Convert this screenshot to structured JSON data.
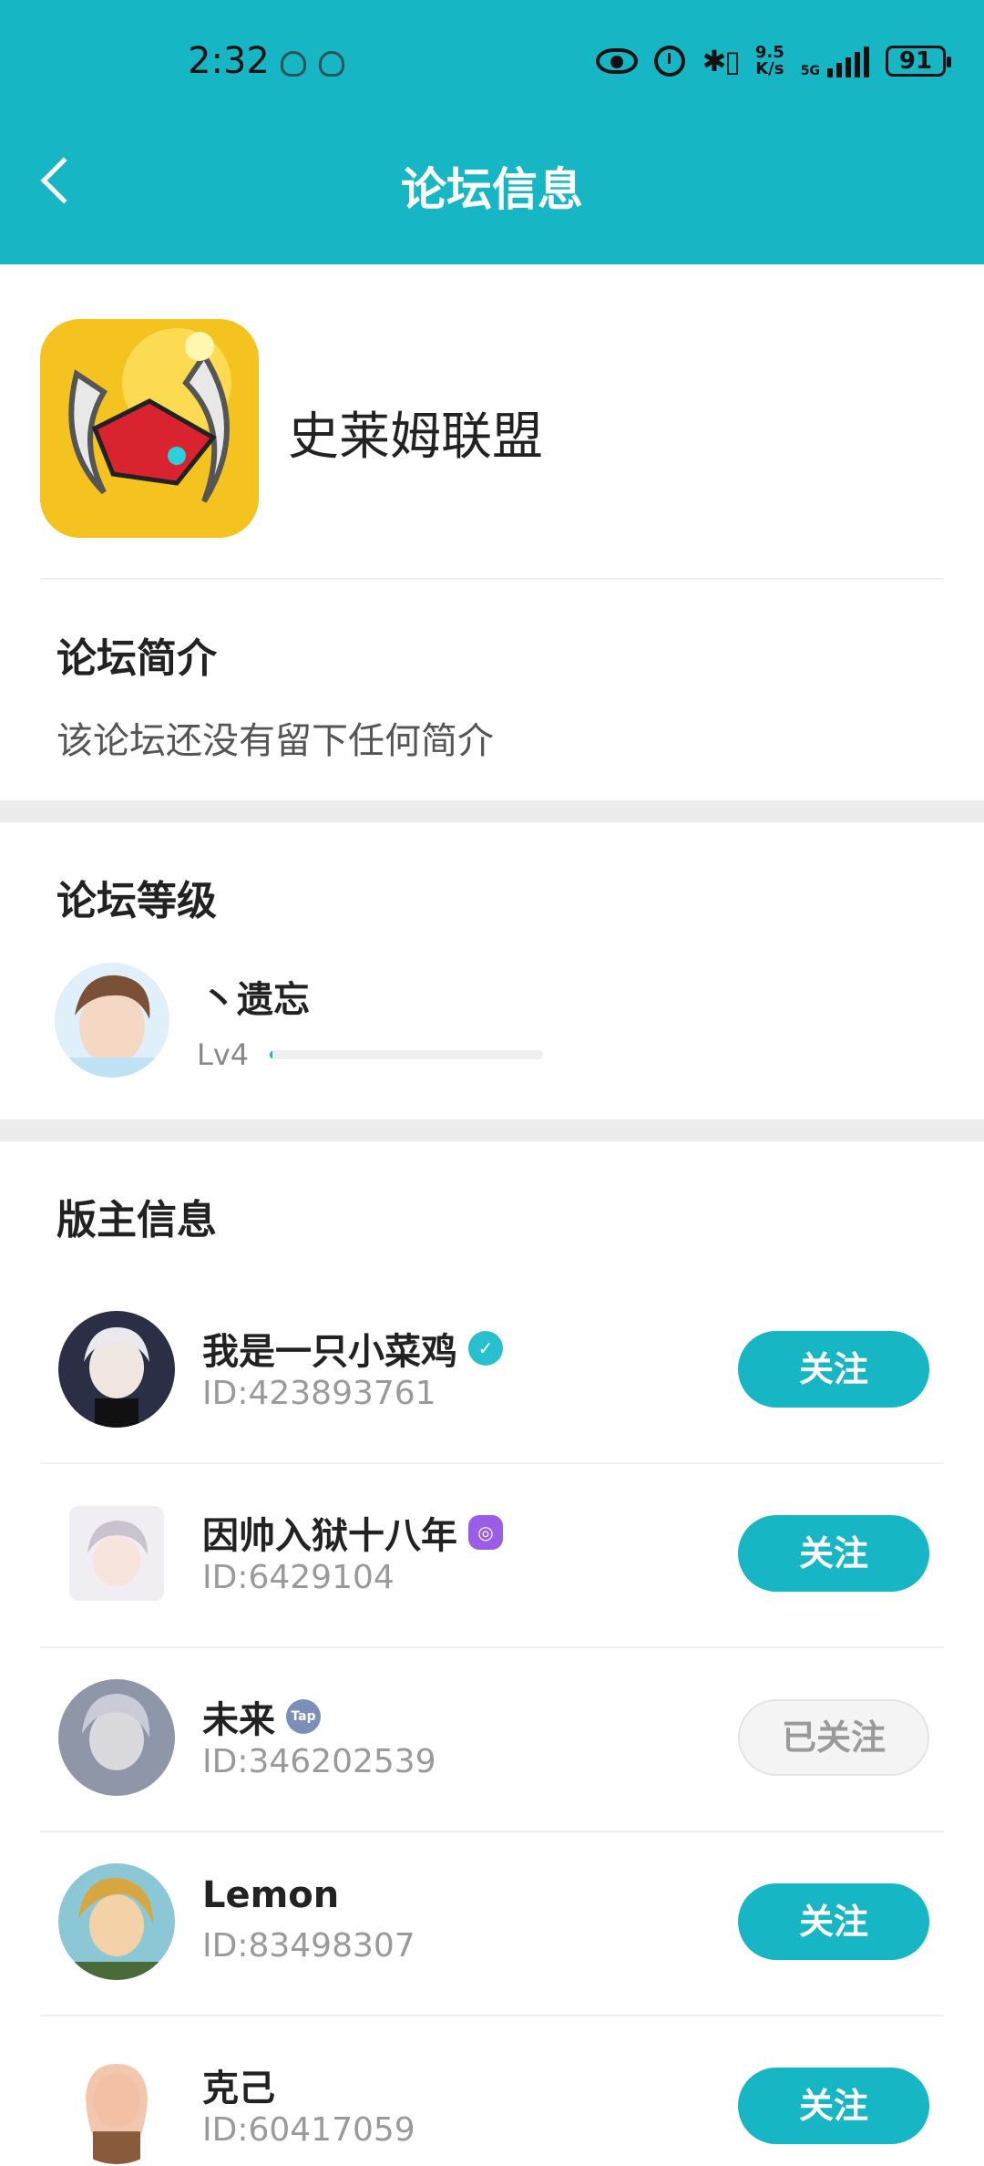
{
  "status_bar": {
    "time": "2:32",
    "net_speed_top": "9.5",
    "net_speed_unit": "K/s",
    "network_type": "5G",
    "battery": "91"
  },
  "header": {
    "title": "论坛信息"
  },
  "forum": {
    "name": "史莱姆联盟"
  },
  "intro": {
    "title": "论坛简介",
    "text": "该论坛还没有留下任何简介"
  },
  "level": {
    "title": "论坛等级",
    "user_name": "丶遗忘",
    "level_label": "Lv4",
    "progress": 0.01
  },
  "moderators": {
    "title": "版主信息",
    "items": [
      {
        "name": "我是一只小菜鸡",
        "id": "ID:423893761",
        "button": "关注",
        "followed": false,
        "badge": "verified-icon"
      },
      {
        "name": "因帅入狱十八年",
        "id": "ID:6429104",
        "button": "关注",
        "followed": false,
        "badge": "gamepad-icon"
      },
      {
        "name": "未来",
        "id": "ID:346202539",
        "button": "已关注",
        "followed": true,
        "badge": "tap-icon"
      },
      {
        "name": "Lemon",
        "id": "ID:83498307",
        "button": "关注",
        "followed": false,
        "badge": ""
      },
      {
        "name": "克己",
        "id": "ID:60417059",
        "button": "关注",
        "followed": false,
        "badge": ""
      }
    ]
  },
  "colors": {
    "accent": "#16b6c5",
    "followed_bg": "#f4f4f4"
  }
}
